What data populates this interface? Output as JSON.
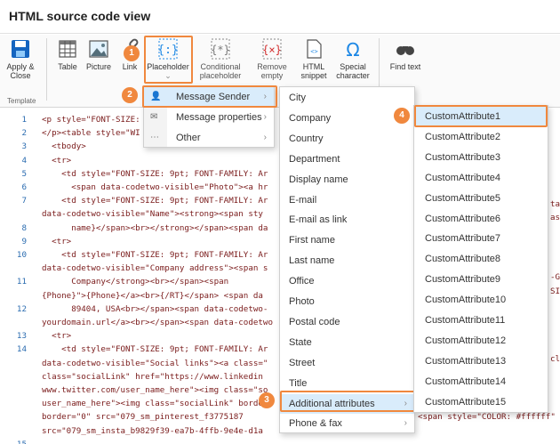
{
  "window": {
    "title": "HTML source code view"
  },
  "ribbon": {
    "group_label": "Template",
    "apply_close": "Apply & Close",
    "table": "Table",
    "picture": "Picture",
    "link": "Link",
    "placeholder": "Placeholder",
    "conditional_placeholder": "Conditional placeholder",
    "remove_empty": "Remove empty",
    "html_snippet": "HTML snippet",
    "special_character": "Special character",
    "find_text": "Find text"
  },
  "badges": [
    "1",
    "2",
    "3",
    "4"
  ],
  "menu1": {
    "items": [
      {
        "label": "Message Sender",
        "icon": "person-icon"
      },
      {
        "label": "Message properties",
        "icon": "envelope-icon"
      },
      {
        "label": "Other",
        "icon": "ellipsis-icon"
      }
    ]
  },
  "menu2": {
    "items": [
      "City",
      "Company",
      "Country",
      "Department",
      "Display name",
      "E-mail",
      "E-mail as link",
      "First name",
      "Last name",
      "Office",
      "Photo",
      "Postal code",
      "State",
      "Street",
      "Title",
      "Additional attributes",
      "Phone & fax"
    ]
  },
  "menu3": {
    "items": [
      "CustomAttribute1",
      "CustomAttribute2",
      "CustomAttribute3",
      "CustomAttribute4",
      "CustomAttribute5",
      "CustomAttribute6",
      "CustomAttribute7",
      "CustomAttribute8",
      "CustomAttribute9",
      "CustomAttribute10",
      "CustomAttribute11",
      "CustomAttribute12",
      "CustomAttribute13",
      "CustomAttribute14",
      "CustomAttribute15"
    ]
  },
  "code": {
    "line_numbers": [
      "1",
      "2",
      "3",
      "4",
      "5",
      "6",
      "7",
      "",
      "8",
      "9",
      "10",
      "",
      "11",
      "",
      "12",
      "",
      "13",
      "14",
      "",
      "",
      "",
      "",
      "",
      "",
      "15"
    ],
    "lines": [
      "<p style=\"FONT-SIZE:",
      "</p><table style=\"WI",
      "  <tbody>",
      "  <tr>",
      "    <td style=\"FONT-SIZE: 9pt; FONT-FAMILY: Ar",
      "      <span data-codetwo-visible=\"Photo\"><a hr",
      "    <td style=\"FONT-SIZE: 9pt; FONT-FAMILY: Ar",
      "data-codetwo-visible=\"Name\"><strong><span sty",
      "      name}</span><br></strong></span><span da",
      "  <tr>",
      "    <td style=\"FONT-SIZE: 9pt; FONT-FAMILY: Ar",
      "data-codetwo-visible=\"Company address\"><span s",
      "      Company</strong><br></span><span",
      "{Phone}\">{Phone}</a><br>{/RT}</span> <span da",
      "      89404, USA<br></span><span data-codetwo-",
      "yourdomain.url</a><br></span><span data-codetwo",
      "  <tr>",
      "    <td style=\"FONT-SIZE: 9pt; FONT-FAMILY: Ar",
      "data-codetwo-visible=\"Social links\"><a class=\"",
      "class=\"socialLink\" href=\"https://www.linkedin",
      "www.twitter.com/user_name_here\"><img class=\"so",
      "user_name_here\"><img class=\"socialLink\" border",
      "border=\"0\" src=\"079_sm_pinterest_f3775187",
      "src=\"079_sm_insta_b9829f39-ea7b-4ffb-9e4e-d1a",
      ""
    ],
    "right_fragments": [
      "ta",
      "as",
      "-GI",
      "SI",
      "cl",
      "<span style=\"COLOR: #ffffff\""
    ]
  },
  "colors": {
    "accent_orange": "#f0883e",
    "selection_blue": "#d9ecfb",
    "link_blue": "#1a1aa6"
  }
}
